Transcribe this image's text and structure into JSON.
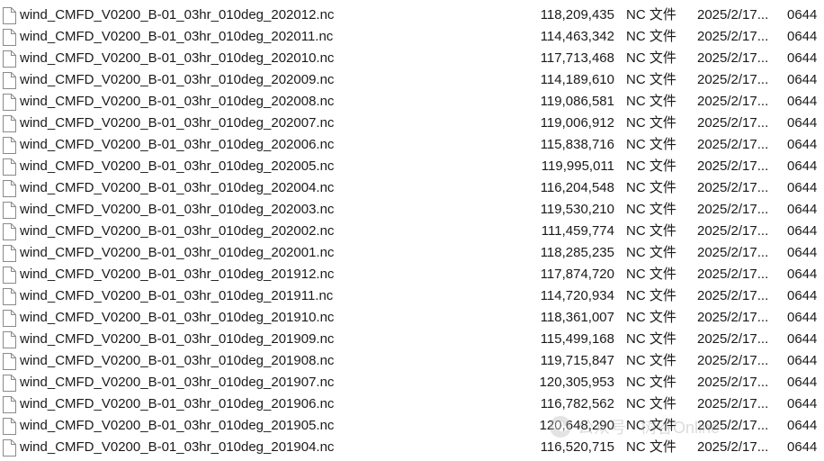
{
  "files": [
    {
      "name": "wind_CMFD_V0200_B-01_03hr_010deg_202012.nc",
      "size": "118,209,435",
      "type": "NC 文件",
      "date": "2025/2/17...",
      "perm": "0644"
    },
    {
      "name": "wind_CMFD_V0200_B-01_03hr_010deg_202011.nc",
      "size": "114,463,342",
      "type": "NC 文件",
      "date": "2025/2/17...",
      "perm": "0644"
    },
    {
      "name": "wind_CMFD_V0200_B-01_03hr_010deg_202010.nc",
      "size": "117,713,468",
      "type": "NC 文件",
      "date": "2025/2/17...",
      "perm": "0644"
    },
    {
      "name": "wind_CMFD_V0200_B-01_03hr_010deg_202009.nc",
      "size": "114,189,610",
      "type": "NC 文件",
      "date": "2025/2/17...",
      "perm": "0644"
    },
    {
      "name": "wind_CMFD_V0200_B-01_03hr_010deg_202008.nc",
      "size": "119,086,581",
      "type": "NC 文件",
      "date": "2025/2/17...",
      "perm": "0644"
    },
    {
      "name": "wind_CMFD_V0200_B-01_03hr_010deg_202007.nc",
      "size": "119,006,912",
      "type": "NC 文件",
      "date": "2025/2/17...",
      "perm": "0644"
    },
    {
      "name": "wind_CMFD_V0200_B-01_03hr_010deg_202006.nc",
      "size": "115,838,716",
      "type": "NC 文件",
      "date": "2025/2/17...",
      "perm": "0644"
    },
    {
      "name": "wind_CMFD_V0200_B-01_03hr_010deg_202005.nc",
      "size": "119,995,011",
      "type": "NC 文件",
      "date": "2025/2/17...",
      "perm": "0644"
    },
    {
      "name": "wind_CMFD_V0200_B-01_03hr_010deg_202004.nc",
      "size": "116,204,548",
      "type": "NC 文件",
      "date": "2025/2/17...",
      "perm": "0644"
    },
    {
      "name": "wind_CMFD_V0200_B-01_03hr_010deg_202003.nc",
      "size": "119,530,210",
      "type": "NC 文件",
      "date": "2025/2/17...",
      "perm": "0644"
    },
    {
      "name": "wind_CMFD_V0200_B-01_03hr_010deg_202002.nc",
      "size": "111,459,774",
      "type": "NC 文件",
      "date": "2025/2/17...",
      "perm": "0644"
    },
    {
      "name": "wind_CMFD_V0200_B-01_03hr_010deg_202001.nc",
      "size": "118,285,235",
      "type": "NC 文件",
      "date": "2025/2/17...",
      "perm": "0644"
    },
    {
      "name": "wind_CMFD_V0200_B-01_03hr_010deg_201912.nc",
      "size": "117,874,720",
      "type": "NC 文件",
      "date": "2025/2/17...",
      "perm": "0644"
    },
    {
      "name": "wind_CMFD_V0200_B-01_03hr_010deg_201911.nc",
      "size": "114,720,934",
      "type": "NC 文件",
      "date": "2025/2/17...",
      "perm": "0644"
    },
    {
      "name": "wind_CMFD_V0200_B-01_03hr_010deg_201910.nc",
      "size": "118,361,007",
      "type": "NC 文件",
      "date": "2025/2/17...",
      "perm": "0644"
    },
    {
      "name": "wind_CMFD_V0200_B-01_03hr_010deg_201909.nc",
      "size": "115,499,168",
      "type": "NC 文件",
      "date": "2025/2/17...",
      "perm": "0644"
    },
    {
      "name": "wind_CMFD_V0200_B-01_03hr_010deg_201908.nc",
      "size": "119,715,847",
      "type": "NC 文件",
      "date": "2025/2/17...",
      "perm": "0644"
    },
    {
      "name": "wind_CMFD_V0200_B-01_03hr_010deg_201907.nc",
      "size": "120,305,953",
      "type": "NC 文件",
      "date": "2025/2/17...",
      "perm": "0644"
    },
    {
      "name": "wind_CMFD_V0200_B-01_03hr_010deg_201906.nc",
      "size": "116,782,562",
      "type": "NC 文件",
      "date": "2025/2/17...",
      "perm": "0644"
    },
    {
      "name": "wind_CMFD_V0200_B-01_03hr_010deg_201905.nc",
      "size": "120,648,290",
      "type": "NC 文件",
      "date": "2025/2/17...",
      "perm": "0644"
    },
    {
      "name": "wind_CMFD_V0200_B-01_03hr_010deg_201904.nc",
      "size": "116,520,715",
      "type": "NC 文件",
      "date": "2025/2/17...",
      "perm": "0644"
    }
  ],
  "icons": {
    "file": "file-icon",
    "watermark_logo": "wechat-logo-icon"
  },
  "watermark": {
    "text": "公众号 · 树谷Online"
  },
  "colors": {
    "text": "#1a1a1a",
    "icon_stroke": "#8a8a8a",
    "background": "#ffffff"
  }
}
